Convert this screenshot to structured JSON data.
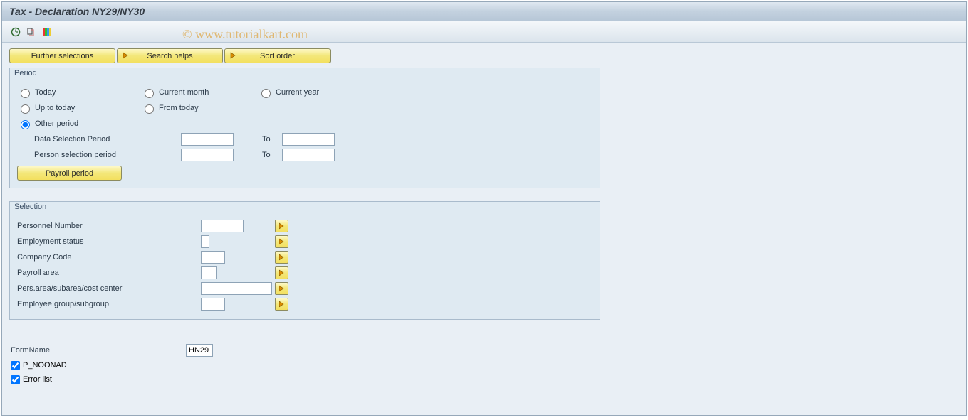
{
  "title": "Tax - Declaration NY29/NY30",
  "watermark": "© www.tutorialkart.com",
  "tab_buttons": {
    "further_selections": "Further selections",
    "search_helps": "Search helps",
    "sort_order": "Sort order"
  },
  "period": {
    "legend": "Period",
    "today": "Today",
    "current_month": "Current month",
    "current_year": "Current year",
    "up_to_today": "Up to today",
    "from_today": "From today",
    "other_period": "Other period",
    "data_selection_period": "Data Selection Period",
    "person_selection_period": "Person selection period",
    "to": "To",
    "payroll_period": "Payroll period"
  },
  "selection": {
    "legend": "Selection",
    "personnel_number": "Personnel Number",
    "employment_status": "Employment status",
    "company_code": "Company Code",
    "payroll_area": "Payroll area",
    "pers_area": "Pers.area/subarea/cost center",
    "employee_group": "Employee group/subgroup"
  },
  "bottom": {
    "form_name_label": "FormName",
    "form_name_value": "HN29",
    "p_noonad": "P_NOONAD",
    "error_list": "Error list"
  }
}
